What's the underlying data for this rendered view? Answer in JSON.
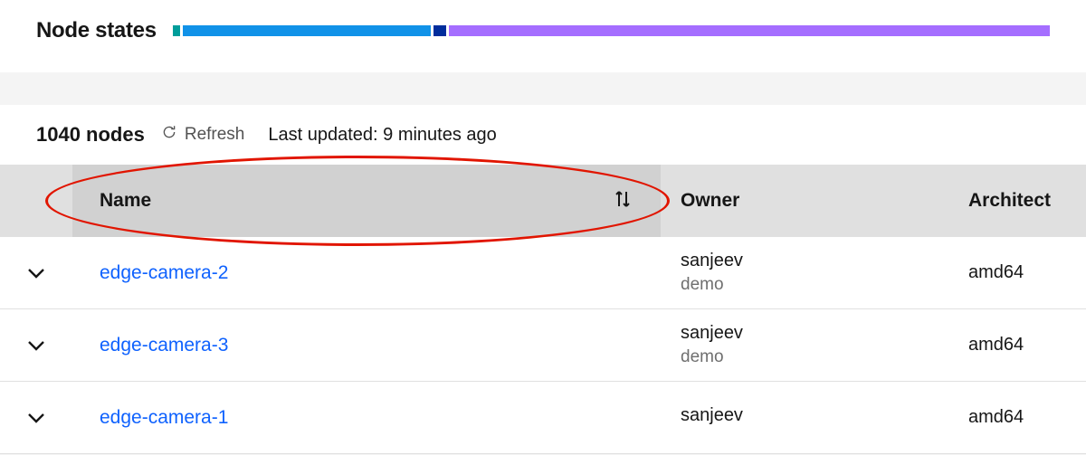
{
  "header": {
    "title": "Node states"
  },
  "toolbar": {
    "count_label": "1040 nodes",
    "refresh_label": "Refresh",
    "last_updated_label": "Last updated: 9 minutes ago"
  },
  "table": {
    "columns": {
      "name": "Name",
      "owner": "Owner",
      "architecture": "Architect"
    },
    "rows": [
      {
        "name": "edge-camera-2",
        "owner": "sanjeev",
        "owner_sub": "demo",
        "architecture": "amd64"
      },
      {
        "name": "edge-camera-3",
        "owner": "sanjeev",
        "owner_sub": "demo",
        "architecture": "amd64"
      },
      {
        "name": "edge-camera-1",
        "owner": "sanjeev",
        "owner_sub": "",
        "architecture": "amd64"
      }
    ]
  }
}
